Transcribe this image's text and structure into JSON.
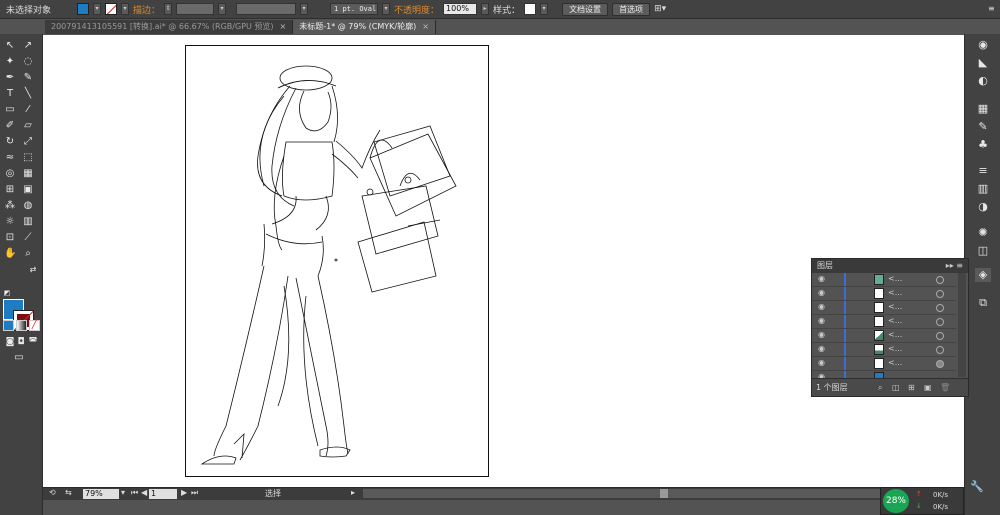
{
  "control_bar": {
    "selection_status": "未选择对象",
    "stroke_label": "描边：",
    "brush_value": "1 pt. Oval",
    "opacity_label": "不透明度：",
    "opacity_value": "100%",
    "style_label": "样式：",
    "doc_setup_button": "文档设置",
    "preferences_button": "首选项",
    "fill_color": "#1e7cc3"
  },
  "tabs": [
    {
      "label": "200791413105591 [转换].ai* @ 66.67% (RGB/GPU 预览)",
      "active": false
    },
    {
      "label": "未标题-1* @ 79% (CMYK/轮廓)",
      "active": true
    }
  ],
  "layers_panel": {
    "title": "图层",
    "layer_name": "<...",
    "footer_count": "1 个图层"
  },
  "status_bar": {
    "zoom": "79%",
    "page": "1",
    "tool_mode": "选择"
  },
  "network_widget": {
    "percent": "28%",
    "upload": "0K/s",
    "download": "0K/s"
  }
}
